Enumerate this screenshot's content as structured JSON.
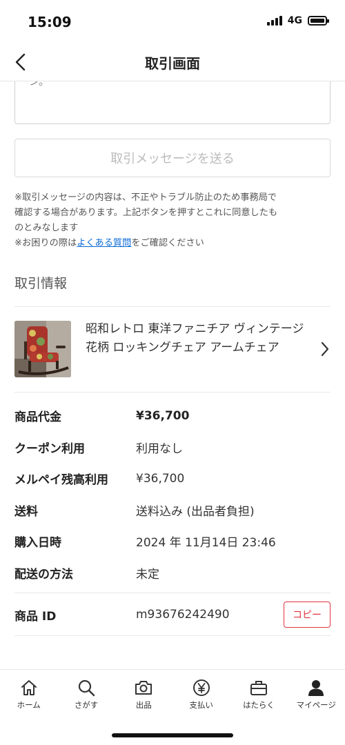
{
  "status_bar": {
    "time": "15:09",
    "network": "4G"
  },
  "nav": {
    "title": "取引画面",
    "back_icon": "chevron-left-icon"
  },
  "message": {
    "textarea_fragment": "ン。",
    "send_label": "取引メッセージを送る",
    "notice_lines": [
      "※取引メッセージの内容は、不正やトラブル防止のため事務局で",
      "確認する場合があります。上記ボタンを押すとこれに同意したも",
      "のとみなします"
    ],
    "help_prefix": "※お困りの際は",
    "help_link": "よくある質問",
    "help_suffix": "をご確認ください"
  },
  "transaction": {
    "section_title": "取引情報",
    "product": {
      "name": "昭和レトロ 東洋ファニチア ヴィンテージ 花柄 ロッキングチェア アームチェア",
      "image": "rocking-chair-photo"
    },
    "rows": [
      {
        "label": "商品代金",
        "value": "¥36,700"
      },
      {
        "label": "クーポン利用",
        "value": "利用なし"
      },
      {
        "label": "メルペイ残高利用",
        "value": "¥36,700"
      },
      {
        "label": "送料",
        "value": "送料込み (出品者負担)"
      },
      {
        "label": "購入日時",
        "value": "2024 年 11月14日 23:46"
      },
      {
        "label": "配送の方法",
        "value": "未定"
      }
    ],
    "product_id": {
      "label": "商品 ID",
      "value": "m93676242490",
      "copy_label": "コピー"
    }
  },
  "tab_bar": {
    "tabs": [
      {
        "label": "ホーム",
        "icon": "home-icon"
      },
      {
        "label": "さがす",
        "icon": "search-icon"
      },
      {
        "label": "出品",
        "icon": "camera-icon"
      },
      {
        "label": "支払い",
        "icon": "yen-circle-icon"
      },
      {
        "label": "はたらく",
        "icon": "briefcase-icon"
      },
      {
        "label": "マイページ",
        "icon": "person-icon"
      }
    ]
  },
  "colors": {
    "accent_red": "#e0343f",
    "link_blue": "#0a6ad6"
  }
}
